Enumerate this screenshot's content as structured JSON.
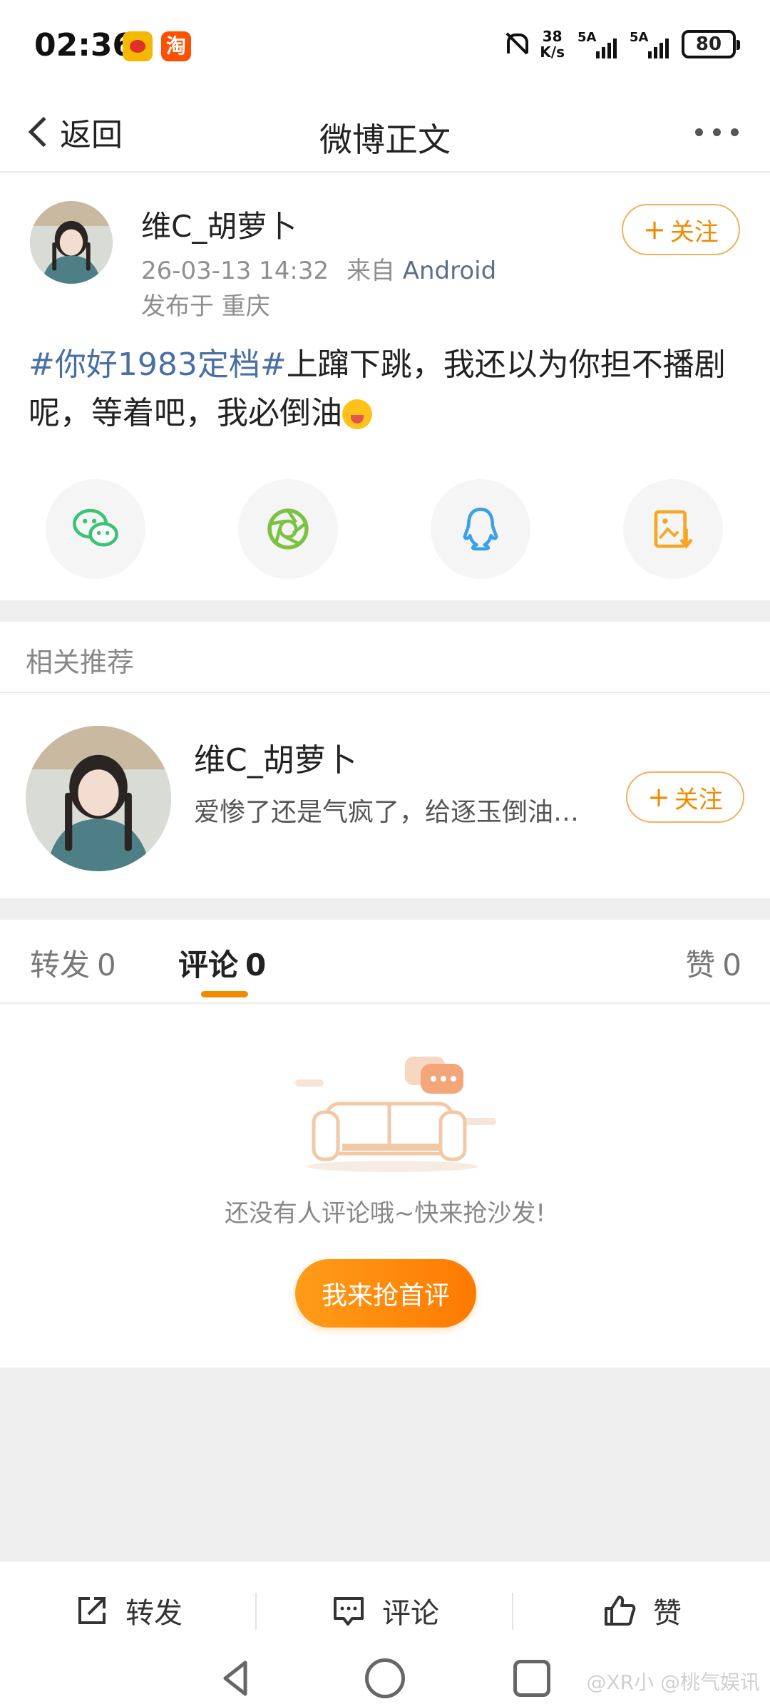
{
  "status_bar": {
    "time": "02:36",
    "taobao_glyph": "淘",
    "net_speed_value": "38",
    "net_speed_unit": "K/s",
    "signal1": "5A",
    "signal2": "5A",
    "battery": "80"
  },
  "nav": {
    "back_label": "返回",
    "title": "微博正文"
  },
  "post": {
    "author": "维C_胡萝卜",
    "date": "26-03-13 14:32",
    "source_prefix": "来自",
    "source": "Android",
    "location": "发布于 重庆",
    "follow_label": "关注",
    "hashtag": "#你好1983定档#",
    "text": "上蹿下跳，我还以为你担不播剧呢，等着吧，我必倒油"
  },
  "share": {
    "icons": [
      "wechat-icon",
      "moments-icon",
      "qq-icon",
      "save-image-icon"
    ],
    "colors": {
      "wechat": "#3cc276",
      "moments": "#7cc242",
      "qq": "#3aa0e8",
      "save": "#f5a623"
    }
  },
  "related": {
    "header": "相关推荐",
    "name": "维C_胡萝卜",
    "desc": "爱惨了还是气疯了，给逐玉倒油…",
    "follow_label": "关注"
  },
  "tabs": {
    "repost_label": "转发",
    "repost_count": "0",
    "comment_label": "评论",
    "comment_count": "0",
    "like_label": "赞",
    "like_count": "0"
  },
  "empty": {
    "message": "还没有人评论哦~快来抢沙发!",
    "button": "我来抢首评"
  },
  "actions": {
    "repost": "转发",
    "comment": "评论",
    "like": "赞"
  },
  "watermark": "@XR小      @桃气娱讯",
  "colors": {
    "accent": "#f08b00",
    "link": "#4a6fa5"
  }
}
